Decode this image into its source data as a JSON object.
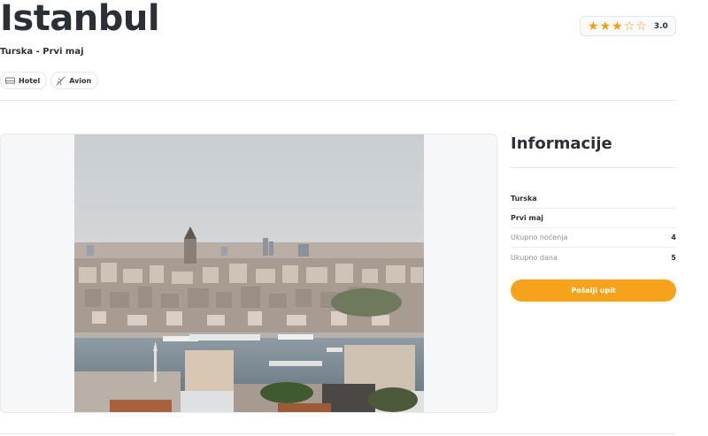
{
  "header": {
    "title": "Istanbul",
    "subtitle": "Turska - Prvi maj",
    "tags": [
      {
        "label": "Hotel",
        "icon": "bed-icon"
      },
      {
        "label": "Avion",
        "icon": "airplane-icon"
      }
    ],
    "rating": {
      "stars_filled": 3,
      "stars_total": 5,
      "value": "3.0",
      "color": "#f59e0b"
    }
  },
  "gallery": {
    "image_description": "Istanbul skyline with Galata Tower over the Golden Horn"
  },
  "info": {
    "title": "Informacije",
    "rows": [
      {
        "label": "Turska",
        "value": ""
      },
      {
        "label": "Prvi maj",
        "value": ""
      },
      {
        "label": "Ukupno noćenja",
        "value": "4"
      },
      {
        "label": "Ukupno dana",
        "value": "5"
      }
    ],
    "cta_label": "Pošalji upit",
    "cta_color": "#f7a21b"
  }
}
